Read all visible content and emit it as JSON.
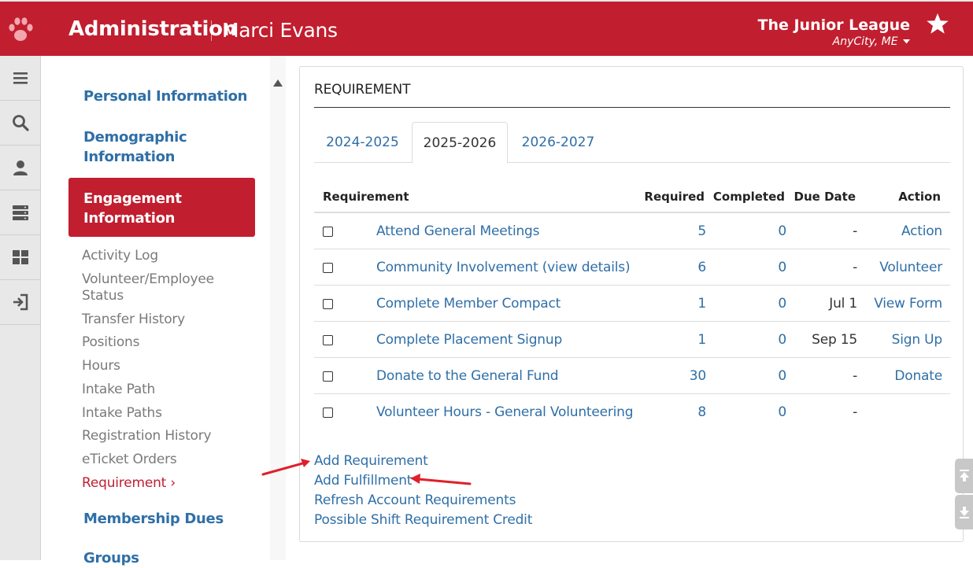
{
  "header": {
    "app_title": "Administration",
    "user_name": "Marci Evans",
    "org_name": "The Junior League",
    "org_city": "AnyCity, ME",
    "brand_color": "#c11e2f",
    "icons": [
      "paw-logo-icon",
      "star-icon",
      "caret-down-icon"
    ]
  },
  "rail": {
    "icons": [
      "menu-icon",
      "search-icon",
      "user-icon",
      "server-icon",
      "grid-icon",
      "sign-in-icon"
    ]
  },
  "leftnav": {
    "personal": "Personal Information",
    "demographic_line1": "Demographic",
    "demographic_line2": "Information",
    "engagement_line1": "Engagement",
    "engagement_line2": "Information",
    "subitems": [
      "Activity Log",
      "Volunteer/Employee",
      "Status",
      "Transfer History",
      "Positions",
      "Hours",
      "Intake Path",
      "Intake Paths",
      "Registration History",
      "eTicket Orders"
    ],
    "current": "Requirement",
    "current_chevron": "›",
    "membership_dues": "Membership Dues",
    "groups": "Groups"
  },
  "panel": {
    "title": "REQUIREMENT",
    "tabs": [
      "2024-2025",
      "2025-2026",
      "2026-2027"
    ],
    "active_tab": "2025-2026",
    "columns": [
      "Requirement",
      "Required",
      "Completed",
      "Due Date",
      "Action"
    ],
    "rows": [
      {
        "name": "Attend General Meetings",
        "required": "5",
        "completed": "0",
        "due": "-",
        "action": "Action"
      },
      {
        "name": "Community Involvement (view details)",
        "required": "6",
        "completed": "0",
        "due": "-",
        "action": "Volunteer"
      },
      {
        "name": "Complete Member Compact",
        "required": "1",
        "completed": "0",
        "due": "Jul 1",
        "action": "View Form"
      },
      {
        "name": "Complete Placement Signup",
        "required": "1",
        "completed": "0",
        "due": "Sep 15",
        "action": "Sign Up"
      },
      {
        "name": "Donate to the General Fund",
        "required": "30",
        "completed": "0",
        "due": "-",
        "action": "Donate"
      },
      {
        "name": "Volunteer Hours - General Volunteering",
        "required": "8",
        "completed": "0",
        "due": "-",
        "action": ""
      }
    ],
    "links": [
      "Add Requirement",
      "Add Fulfillment",
      "Refresh Account Requirements",
      "Possible Shift Requirement Credit"
    ]
  },
  "colors": {
    "link": "#2f6fa7",
    "annotation_arrow": "#e0202a"
  }
}
